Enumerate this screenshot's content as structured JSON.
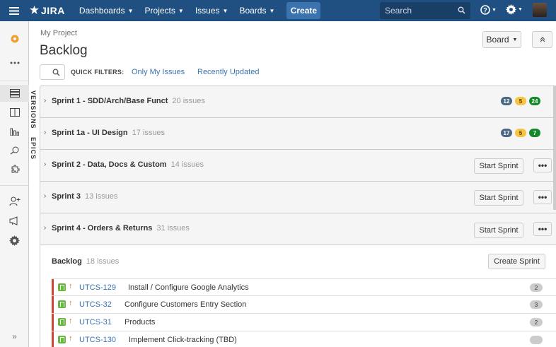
{
  "nav": {
    "logo": "JIRA",
    "items": [
      {
        "label": "Dashboards"
      },
      {
        "label": "Projects"
      },
      {
        "label": "Issues"
      },
      {
        "label": "Boards"
      }
    ],
    "create_label": "Create",
    "search_placeholder": "Search",
    "accent": "#205081"
  },
  "sidebar": {
    "icons": [
      "project-avatar-icon",
      "more-icon",
      "backlog-icon",
      "board-icon",
      "reports-icon",
      "search-issues-icon",
      "components-icon",
      "add-user-icon",
      "announce-icon",
      "settings-icon"
    ]
  },
  "vtabs": {
    "versions": "VERSIONS",
    "epics": "EPICS"
  },
  "header": {
    "breadcrumb": "My Project",
    "title": "Backlog",
    "board_label": "Board",
    "quick_filters_label": "QUICK FILTERS:",
    "filters": [
      "Only My Issues",
      "Recently Updated"
    ]
  },
  "sprints": [
    {
      "name": "Sprint 1 - SDD/Arch/Base Funct",
      "count": "20 issues",
      "badges": [
        "12",
        "5",
        "24"
      ]
    },
    {
      "name": "Sprint 1a - UI Design",
      "count": "17 issues",
      "badges": [
        "17",
        "5",
        "7"
      ]
    },
    {
      "name": "Sprint 2 - Data, Docs & Custom",
      "count": "14 issues",
      "action": "Start Sprint",
      "more": "•••"
    },
    {
      "name": "Sprint 3",
      "count": "13 issues",
      "action": "Start Sprint",
      "more": "•••"
    },
    {
      "name": "Sprint 4 - Orders & Returns",
      "count": "31 issues",
      "action": "Start Sprint",
      "more": "•••"
    }
  ],
  "backlog": {
    "title": "Backlog",
    "count": "18 issues",
    "create_sprint": "Create Sprint",
    "issues": [
      {
        "key": "UTCS-129",
        "summary": "Install / Configure Google Analytics",
        "estimate": "2"
      },
      {
        "key": "UTCS-32",
        "summary": "Configure Customers Entry Section",
        "estimate": "3"
      },
      {
        "key": "UTCS-31",
        "summary": "Products",
        "estimate": "2"
      },
      {
        "key": "UTCS-130",
        "summary": "Implement Click-tracking (TBD)",
        "estimate": ""
      }
    ]
  }
}
